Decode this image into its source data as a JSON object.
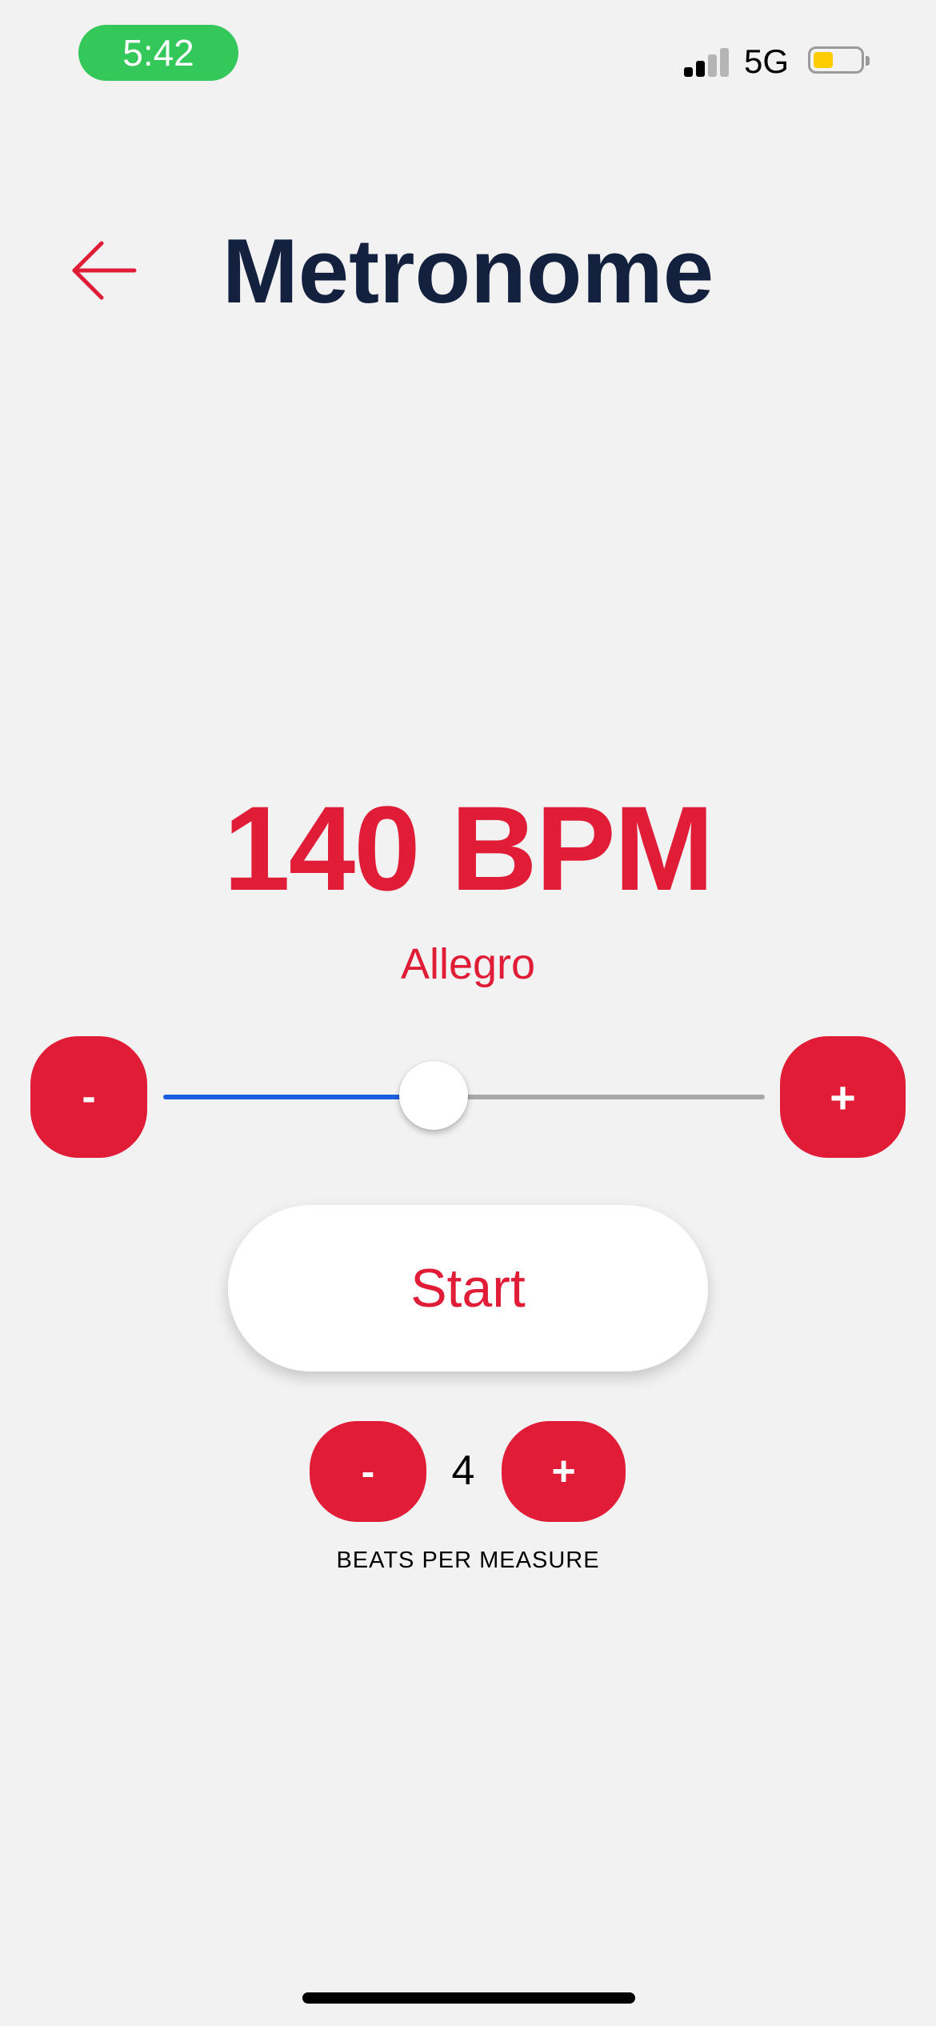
{
  "status_bar": {
    "time": "5:42",
    "network": "5G",
    "colors": {
      "time_pill": "#34c759",
      "battery_fill": "#ffcc00"
    }
  },
  "header": {
    "back_icon": "arrow-left-icon",
    "title": "Metronome"
  },
  "tempo": {
    "bpm_text": "140 BPM",
    "bpm": 140,
    "tempo_name": "Allegro",
    "minus_label": "-",
    "plus_label": "+",
    "slider_fraction": 0.45
  },
  "start_label": "Start",
  "beats": {
    "minus_label": "-",
    "value": "4",
    "plus_label": "+",
    "label": "BEATS PER MEASURE"
  },
  "colors": {
    "accent": "#e01c36",
    "title": "#13213f",
    "slider_active": "#1a5fe0",
    "slider_inactive": "#a8a8a8",
    "background": "#f2f2f2"
  }
}
